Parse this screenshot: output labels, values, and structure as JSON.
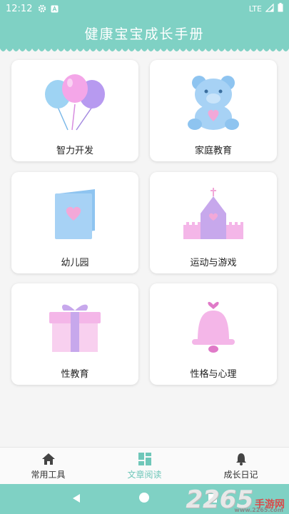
{
  "status_bar": {
    "time": "12:12",
    "network": "LTE"
  },
  "header": {
    "title": "健康宝宝成长手册"
  },
  "categories": [
    {
      "label": "智力开发",
      "icon": "balloons-icon"
    },
    {
      "label": "家庭教育",
      "icon": "teddy-bear-icon"
    },
    {
      "label": "幼儿园",
      "icon": "card-heart-icon"
    },
    {
      "label": "运动与游戏",
      "icon": "castle-icon"
    },
    {
      "label": "性教育",
      "icon": "gift-box-icon"
    },
    {
      "label": "性格与心理",
      "icon": "bell-icon"
    }
  ],
  "bottom_nav": {
    "items": [
      {
        "label": "常用工具",
        "icon": "home-icon"
      },
      {
        "label": "文章阅读",
        "icon": "grid-icon"
      },
      {
        "label": "成长日记",
        "icon": "bell-icon"
      }
    ],
    "active_index": 1
  },
  "watermark": {
    "num": "2265",
    "text": "手游网",
    "url": "www.2265.com"
  },
  "colors": {
    "primary": "#7fd1c4",
    "active_tab": "#6fc7b9"
  }
}
